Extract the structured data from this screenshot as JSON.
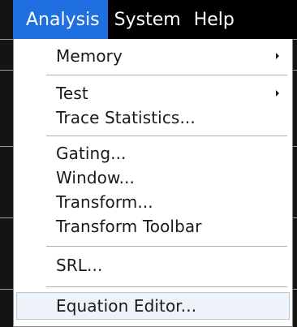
{
  "menubar": {
    "items": [
      {
        "label": "Analysis"
      },
      {
        "label": "System"
      },
      {
        "label": "Help"
      }
    ]
  },
  "dropdown": {
    "groups": [
      [
        {
          "label": "Memory",
          "submenu": true
        }
      ],
      [
        {
          "label": "Test",
          "submenu": true
        },
        {
          "label": "Trace Statistics..."
        }
      ],
      [
        {
          "label": "Gating..."
        },
        {
          "label": "Window..."
        },
        {
          "label": "Transform..."
        },
        {
          "label": "Transform Toolbar"
        }
      ],
      [
        {
          "label": "SRL..."
        }
      ],
      [
        {
          "label": "Equation Editor..."
        }
      ]
    ]
  },
  "colors": {
    "menubar_bg": "#000000",
    "active_menu_bg": "#1f6fe0",
    "menu_bg": "#ffffff",
    "hover_bg": "#eef3f9"
  }
}
